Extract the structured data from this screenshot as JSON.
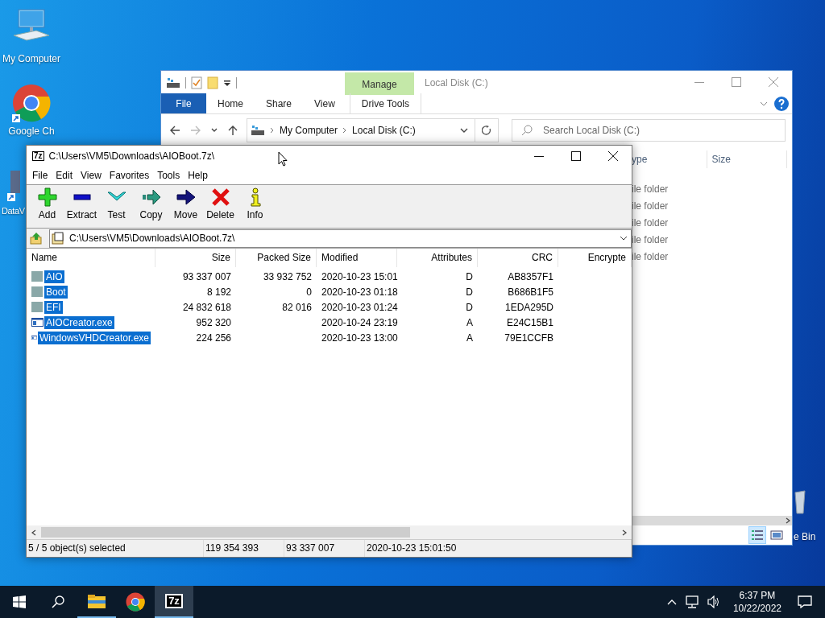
{
  "desktop_icons": [
    {
      "kind": "computer",
      "label": "My Computer"
    },
    {
      "kind": "chrome",
      "label": "Google Ch"
    },
    {
      "kind": "shortcut",
      "label": "DataV"
    },
    {
      "kind": "recycle",
      "label": "e Bin"
    }
  ],
  "explorer": {
    "title": "Local Disk (C:)",
    "contextual_header": "Manage",
    "tabs": [
      {
        "kind": "file",
        "label": "File"
      },
      {
        "kind": "tab",
        "label": "Home"
      },
      {
        "kind": "tab",
        "label": "Share"
      },
      {
        "kind": "tab",
        "label": "View"
      },
      {
        "kind": "contextual",
        "label": "Drive Tools"
      }
    ],
    "nav": [
      {
        "kind": "back",
        "disabled": false
      },
      {
        "kind": "forward",
        "disabled": true
      },
      {
        "kind": "recent",
        "disabled": false
      },
      {
        "kind": "up",
        "disabled": false
      }
    ],
    "breadcrumbs": [
      "My Computer",
      "Local Disk (C:)"
    ],
    "search": {
      "placeholder": "Search Local Disk (C:)"
    },
    "columns": [
      "ype",
      "Size"
    ],
    "rows": [
      {
        "type": "ile folder"
      },
      {
        "type": "ile folder"
      },
      {
        "type": "ile folder"
      },
      {
        "type": "ile folder"
      },
      {
        "type": "ile folder"
      }
    ],
    "views": [
      {
        "kind": "details",
        "selected": true
      },
      {
        "kind": "large",
        "selected": false
      }
    ]
  },
  "sevenzip": {
    "icon_text": "7z",
    "title": "C:\\Users\\VM5\\Downloads\\AIOBoot.7z\\",
    "menu": [
      "File",
      "Edit",
      "View",
      "Favorites",
      "Tools",
      "Help"
    ],
    "toolbar": [
      {
        "kind": "add",
        "label": "Add"
      },
      {
        "kind": "extract",
        "label": "Extract"
      },
      {
        "kind": "test",
        "label": "Test"
      },
      {
        "kind": "copy",
        "label": "Copy"
      },
      {
        "kind": "move",
        "label": "Move"
      },
      {
        "kind": "delete",
        "label": "Delete"
      },
      {
        "kind": "info",
        "label": "Info"
      }
    ],
    "path": "C:\\Users\\VM5\\Downloads\\AIOBoot.7z\\",
    "columns": [
      "Name",
      "Size",
      "Packed Size",
      "Modified",
      "Attributes",
      "CRC",
      "Encrypte"
    ],
    "rows": [
      {
        "kind": "folder",
        "name": "AIO",
        "size": "93 337 007",
        "packed_size": "33 932 752",
        "modified": "2020-10-23 15:01",
        "attributes": "D",
        "crc": "AB8357F1",
        "selected": true
      },
      {
        "kind": "folder",
        "name": "Boot",
        "size": "8 192",
        "packed_size": "0",
        "modified": "2020-10-23 01:18",
        "attributes": "D",
        "crc": "B686B1F5",
        "selected": true
      },
      {
        "kind": "folder",
        "name": "EFI",
        "size": "24 832 618",
        "packed_size": "82 016",
        "modified": "2020-10-23 01:24",
        "attributes": "D",
        "crc": "1EDA295D",
        "selected": true
      },
      {
        "kind": "exe",
        "name": "AIOCreator.exe",
        "size": "952 320",
        "packed_size": "",
        "modified": "2020-10-24 23:19",
        "attributes": "A",
        "crc": "E24C15B1",
        "selected": true
      },
      {
        "kind": "exe",
        "name": "WindowsVHDCreator.exe",
        "size": "224 256",
        "packed_size": "",
        "modified": "2020-10-23 13:00",
        "attributes": "A",
        "crc": "79E1CCFB",
        "selected": true
      }
    ],
    "status": [
      "5 / 5 object(s) selected",
      "119 354 393",
      "93 337 007",
      "2020-10-23 15:01:50"
    ]
  },
  "taskbar": {
    "items": [
      {
        "kind": "start"
      },
      {
        "kind": "search"
      },
      {
        "kind": "explorer",
        "running": true,
        "selected": false
      },
      {
        "kind": "chrome",
        "running": false,
        "selected": false
      },
      {
        "kind": "sevenzip",
        "label": "7z",
        "running": true,
        "selected": true
      }
    ],
    "time": "6:37 PM",
    "date": "10/22/2022"
  }
}
